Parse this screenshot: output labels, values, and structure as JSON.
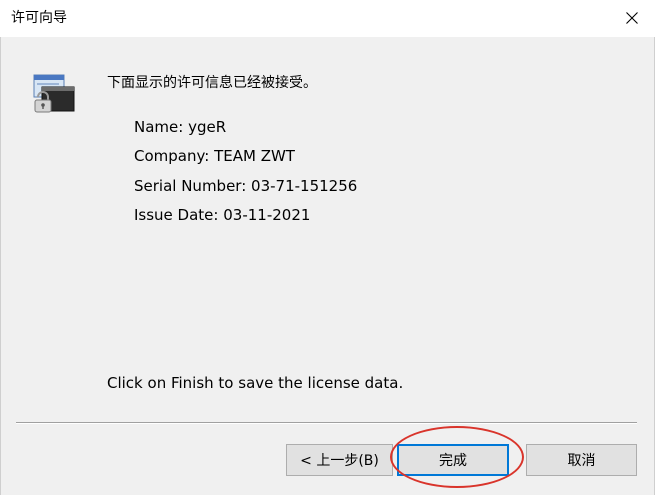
{
  "window": {
    "title": "许可向导",
    "close_icon": "close-icon"
  },
  "content": {
    "heading": "下面显示的许可信息已经被接受。",
    "info": [
      "Name: ygeR",
      "Company: TEAM ZWT",
      "Serial Number: 03-71-151256",
      "Issue Date: 03-11-2021"
    ],
    "footer_note": "Click on Finish to save the license data.",
    "icon": "license-wizard-icon"
  },
  "buttons": {
    "back_label": "< 上一步(B)",
    "finish_label": "完成",
    "cancel_label": "取消"
  },
  "colors": {
    "focus_border": "#0078d7",
    "annotation": "#d9342b"
  }
}
